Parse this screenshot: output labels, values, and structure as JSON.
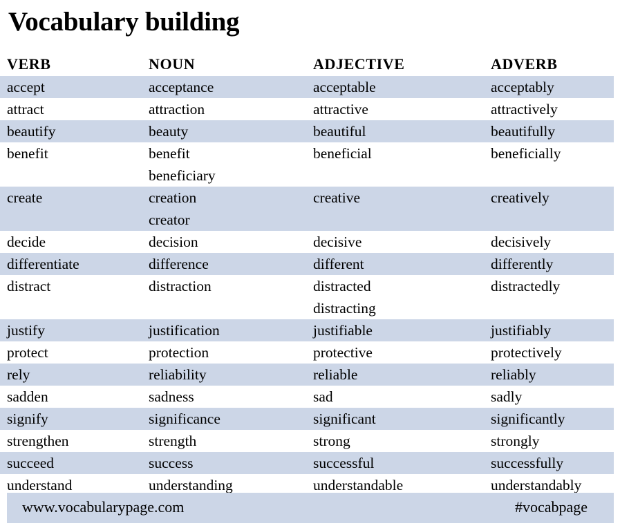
{
  "page": {
    "title": "Vocabulary building",
    "band_color": "#ccd6e7",
    "text_color": "#000000",
    "background_color": "#ffffff"
  },
  "table": {
    "headers": [
      "VERB",
      "NOUN",
      "ADJECTIVE",
      "ADVERB"
    ],
    "rows": [
      {
        "shaded": true,
        "lines": 1,
        "verb": "accept",
        "noun": "acceptance",
        "adjective": "acceptable",
        "adverb": "acceptably"
      },
      {
        "shaded": false,
        "lines": 1,
        "verb": "attract",
        "noun": "attraction",
        "adjective": "attractive",
        "adverb": "attractively"
      },
      {
        "shaded": true,
        "lines": 1,
        "verb": "beautify",
        "noun": "beauty",
        "adjective": "beautiful",
        "adverb": "beautifully"
      },
      {
        "shaded": false,
        "lines": 2,
        "verb": "benefit",
        "noun": "benefit\nbeneficiary",
        "adjective": "beneficial",
        "adverb": "beneficially"
      },
      {
        "shaded": true,
        "lines": 2,
        "verb": "create",
        "noun": "creation\ncreator",
        "adjective": "creative",
        "adverb": "creatively"
      },
      {
        "shaded": false,
        "lines": 1,
        "verb": "decide",
        "noun": "decision",
        "adjective": "decisive",
        "adverb": "decisively"
      },
      {
        "shaded": true,
        "lines": 1,
        "verb": "differentiate",
        "noun": "difference",
        "adjective": "different",
        "adverb": "differently"
      },
      {
        "shaded": false,
        "lines": 2,
        "verb": "distract",
        "noun": "distraction",
        "adjective": "distracted\ndistracting",
        "adverb": "distractedly"
      },
      {
        "shaded": true,
        "lines": 1,
        "verb": "justify",
        "noun": "justification",
        "adjective": "justifiable",
        "adverb": "justifiably"
      },
      {
        "shaded": false,
        "lines": 1,
        "verb": "protect",
        "noun": "protection",
        "adjective": "protective",
        "adverb": "protectively"
      },
      {
        "shaded": true,
        "lines": 1,
        "verb": "rely",
        "noun": "reliability",
        "adjective": "reliable",
        "adverb": "reliably"
      },
      {
        "shaded": false,
        "lines": 1,
        "verb": "sadden",
        "noun": "sadness",
        "adjective": "sad",
        "adverb": "sadly"
      },
      {
        "shaded": true,
        "lines": 1,
        "verb": "signify",
        "noun": "significance",
        "adjective": "significant",
        "adverb": "significantly"
      },
      {
        "shaded": false,
        "lines": 1,
        "verb": "strengthen",
        "noun": "strength",
        "adjective": "strong",
        "adverb": "strongly"
      },
      {
        "shaded": true,
        "lines": 1,
        "verb": "succeed",
        "noun": "success",
        "adjective": "successful",
        "adverb": "successfully"
      },
      {
        "shaded": false,
        "lines": 1,
        "verb": "understand",
        "noun": "understanding",
        "adjective": "understandable",
        "adverb": "understandably"
      }
    ]
  },
  "footer": {
    "website": "www.vocabularypage.com",
    "hashtag": "#vocabpage"
  }
}
